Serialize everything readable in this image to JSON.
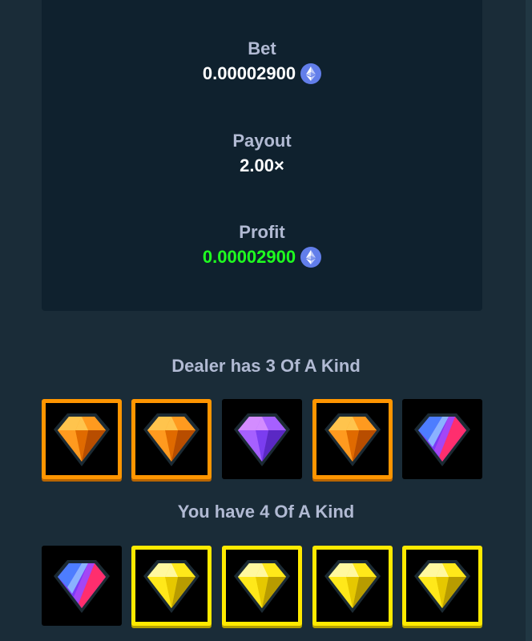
{
  "result": {
    "bet_label": "Bet",
    "bet_value": "0.00002900",
    "payout_label": "Payout",
    "payout_value": "2.00×",
    "profit_label": "Profit",
    "profit_value": "0.00002900",
    "currency_icon": "ethereum-icon"
  },
  "dealer": {
    "title": "Dealer has 3 Of A Kind",
    "cards": [
      {
        "gem": "orange",
        "highlighted": true
      },
      {
        "gem": "orange",
        "highlighted": true
      },
      {
        "gem": "purple",
        "highlighted": false
      },
      {
        "gem": "orange",
        "highlighted": true
      },
      {
        "gem": "multicolor",
        "highlighted": false
      }
    ]
  },
  "player": {
    "title": "You have 4 Of A Kind",
    "cards": [
      {
        "gem": "multicolor",
        "highlighted": false
      },
      {
        "gem": "yellow",
        "highlighted": true
      },
      {
        "gem": "yellow",
        "highlighted": true
      },
      {
        "gem": "yellow",
        "highlighted": true
      },
      {
        "gem": "yellow",
        "highlighted": true
      }
    ]
  },
  "colors": {
    "background": "#1a2c38",
    "panel": "#0f212e",
    "label": "#b1bad3",
    "profit_green": "#1fff20",
    "highlight_orange": "#ff9500",
    "highlight_yellow": "#ffea00"
  }
}
